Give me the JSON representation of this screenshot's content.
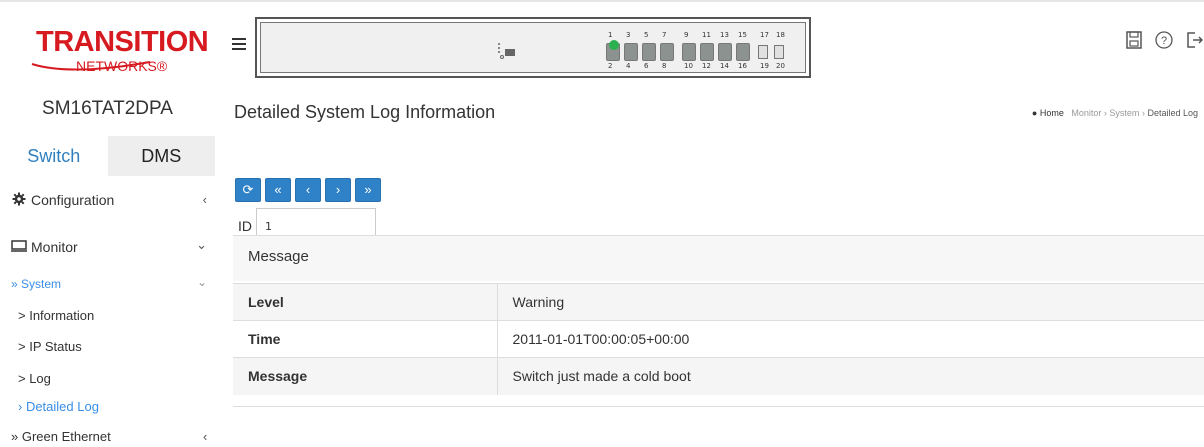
{
  "header": {
    "logo_text": "TRANSITION",
    "logo_sub": "NETWORKS®",
    "port_top_numbers": [
      "1",
      "3",
      "5",
      "7",
      "9",
      "11",
      "13",
      "15",
      "17",
      "18"
    ],
    "port_bottom_numbers": [
      "2",
      "4",
      "6",
      "8",
      "10",
      "12",
      "14",
      "16",
      "19",
      "20"
    ],
    "icons": [
      "save-icon",
      "help-icon",
      "logout-icon"
    ],
    "led_color": "#2bb050"
  },
  "sidebar": {
    "model": "SM16TAT2DPA",
    "tabs": [
      {
        "label": "Switch"
      },
      {
        "label": "DMS"
      }
    ],
    "configuration": "Configuration",
    "configuration_chev": "‹",
    "monitor": "Monitor",
    "monitor_chev": "⌄",
    "system": "» System",
    "system_chev": "⌄",
    "items": [
      {
        "label": "> Information"
      },
      {
        "label": "> IP Status"
      },
      {
        "label": "> Log"
      },
      {
        "label": "› Detailed Log"
      }
    ],
    "green_ethernet": "» Green Ethernet",
    "green_chev": "‹"
  },
  "main": {
    "title": "Detailed System Log Information",
    "breadcrumb": {
      "home": "Home",
      "monitor": "Monitor",
      "system": "System",
      "current": "Detailed Log",
      "sep": "›"
    },
    "buttons": {
      "refresh": "⟳",
      "first": "«",
      "prev": "‹",
      "next": "›",
      "last": "»"
    },
    "id_label": "ID",
    "id_value": "1",
    "section_title": "Message",
    "rows": [
      {
        "key": "Level",
        "value": "Warning"
      },
      {
        "key": "Time",
        "value": "2011-01-01T00:00:05+00:00"
      },
      {
        "key": "Message",
        "value": "Switch just made a cold boot"
      }
    ]
  },
  "colors": {
    "accent": "#2f82c7",
    "brand_red": "#d71920",
    "link_blue": "#3a8ee6"
  }
}
